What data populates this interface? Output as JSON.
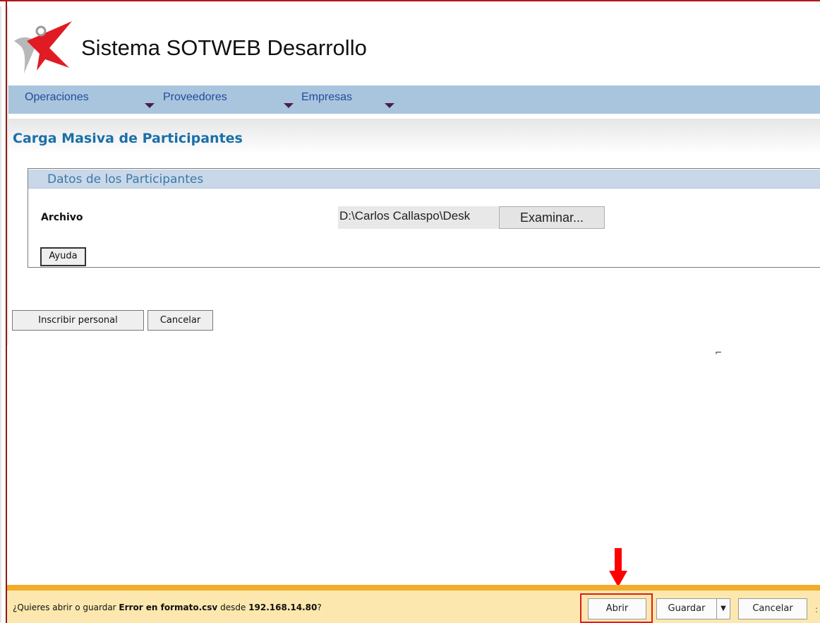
{
  "header": {
    "title": "Sistema SOTWEB Desarrollo",
    "logo_icon": "sotweb-logo-icon"
  },
  "menu": [
    {
      "label": "Operaciones"
    },
    {
      "label": "Proveedores"
    },
    {
      "label": "Empresas"
    }
  ],
  "page": {
    "title": "Carga Masiva de Participantes"
  },
  "form": {
    "fieldset_title": "Datos de los Participantes",
    "file_label": "Archivo",
    "file_value": "D:\\Carlos Callaspo\\Desk",
    "browse_label": "Examinar...",
    "help_label": "Ayuda"
  },
  "actions": {
    "submit_label": "Inscribir personal",
    "cancel_label": "Cancelar"
  },
  "download_bar": {
    "prefix": "¿Quieres abrir o guardar ",
    "filename": "Error en formato.csv",
    "middle": " desde ",
    "host": "192.168.14.80",
    "suffix": "?",
    "open_label": "Abrir",
    "save_label": "Guardar",
    "cancel_label": "Cancelar"
  },
  "colors": {
    "menu_bg": "#a9c4dd",
    "menu_text": "#1f4e9c",
    "title_blue": "#1a6fa8",
    "download_bar_bg": "#fce8ae",
    "download_bar_border": "#f2ac2a",
    "annotation_red": "#ff0000"
  }
}
